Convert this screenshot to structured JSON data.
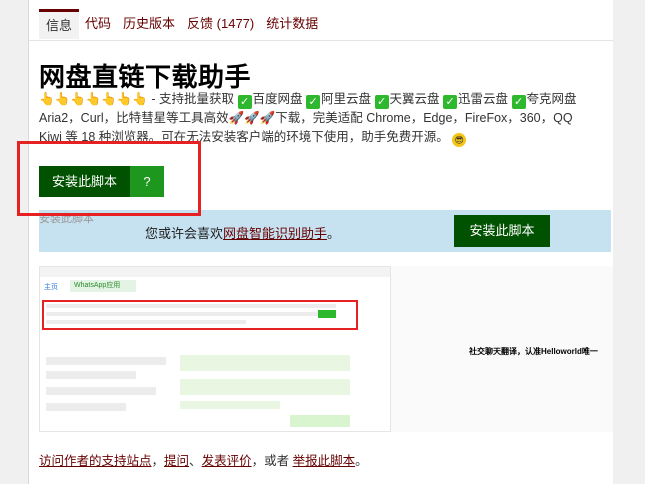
{
  "tabs": [
    "信息",
    "代码",
    "历史版本",
    "反馈 (1477)",
    "统计数据"
  ],
  "title": "网盘直链下载助手",
  "desc": {
    "hands": "👆👆👆👆👆👆👆",
    "intro": " - 支持批量获取 ",
    "services": [
      "百度网盘",
      "阿里云盘",
      "天翼云盘",
      "迅雷云盘",
      "夸克网盘"
    ],
    "line2": "Aria2，Curl，比特彗星等工具高效🚀🚀🚀下载，完美适配 Chrome，Edge，FireFox，360，QQ",
    "line3": "Kiwi 等 18 种浏览器。可在无法安装客户端的环境下使用，助手免费开源。"
  },
  "install": {
    "label": "安装此脚本",
    "help": "?"
  },
  "hidden_label": "安装此脚本",
  "promo": {
    "text_before": "您或许会喜欢",
    "link": "网盘智能识别助手",
    "text_after": "。",
    "button": "安装此脚本"
  },
  "screenshot": {
    "caption": "社交聊天翻译，认准Helloworld唯一",
    "tabs": [
      "主页",
      "WhatsApp应用"
    ]
  },
  "footer": {
    "link1": "访问作者的支持站点",
    "sep1": "，",
    "link2": "提问",
    "sep2": "、",
    "link3": "发表评价",
    "sep3": "，或者 ",
    "link4": "举报此脚本",
    "end": "。"
  },
  "colors": {
    "link": "#670000",
    "install_green": "#005200",
    "help_green": "#1e971e",
    "promo_bg": "#c6e2f1",
    "highlight_red": "#e52121"
  }
}
